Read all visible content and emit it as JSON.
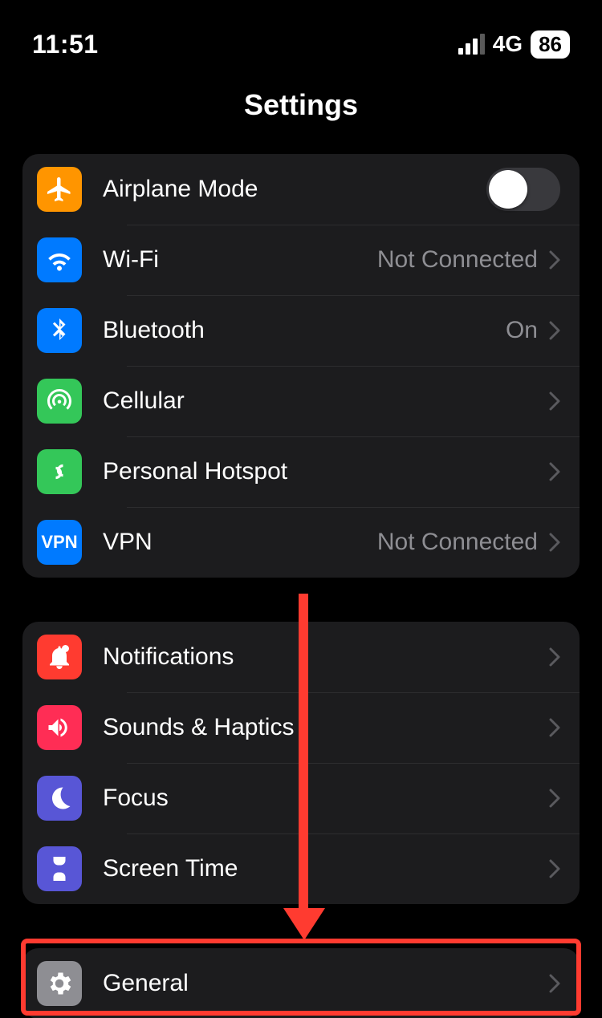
{
  "status": {
    "time": "11:51",
    "network_label": "4G",
    "battery_percent": "86",
    "signal_strength": 3
  },
  "header": {
    "title": "Settings"
  },
  "group1": {
    "airplane": {
      "label": "Airplane Mode",
      "toggled": false
    },
    "wifi": {
      "label": "Wi-Fi",
      "value": "Not Connected"
    },
    "bluetooth": {
      "label": "Bluetooth",
      "value": "On"
    },
    "cellular": {
      "label": "Cellular",
      "value": ""
    },
    "hotspot": {
      "label": "Personal Hotspot",
      "value": ""
    },
    "vpn": {
      "label": "VPN",
      "value": "Not Connected",
      "icon_text": "VPN"
    }
  },
  "group2": {
    "notifications": {
      "label": "Notifications"
    },
    "sounds": {
      "label": "Sounds & Haptics"
    },
    "focus": {
      "label": "Focus"
    },
    "screentime": {
      "label": "Screen Time"
    }
  },
  "group3": {
    "general": {
      "label": "General"
    }
  },
  "annotation": {
    "highlighted_item": "general",
    "arrow_color": "#ff3b30"
  }
}
